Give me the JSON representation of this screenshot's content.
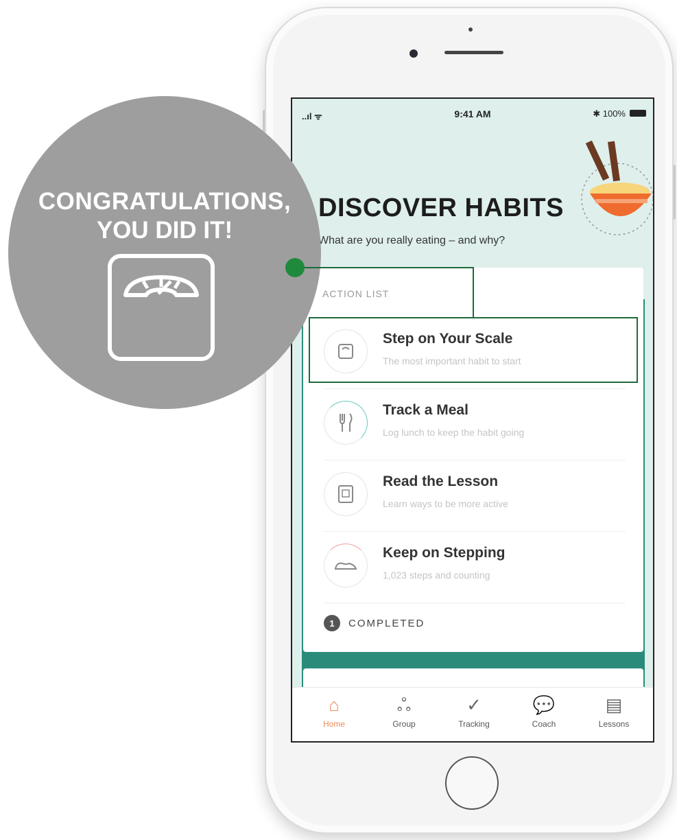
{
  "promo": {
    "congrats_line1": "CONGRATULATIONS,",
    "congrats_line2": "YOU DID IT!",
    "scale_icon": "bathroom-scale-icon",
    "accent_color": "#1f8a3c"
  },
  "status_bar": {
    "signal": "..ıl ᯤ",
    "time": "9:41 AM",
    "battery": "✱ 100%"
  },
  "header": {
    "title": "DISCOVER HABITS",
    "subtitle": "What are you really eating – and why?"
  },
  "action_list": {
    "label": "ACTION LIST",
    "items": [
      {
        "title": "Step on Your Scale",
        "subtitle": "The most important habit to start",
        "icon": "scale-icon"
      },
      {
        "title": "Track a Meal",
        "subtitle": "Log lunch to keep the habit going",
        "icon": "utensils-icon"
      },
      {
        "title": "Read the Lesson",
        "subtitle": "Learn ways to be more active",
        "icon": "book-icon"
      },
      {
        "title": "Keep on Stepping",
        "subtitle": "1,023 steps and counting",
        "icon": "shoe-icon"
      }
    ],
    "completed_count": "1",
    "completed_label": "COMPLETED"
  },
  "tabbar": {
    "tabs": [
      {
        "label": "Home",
        "icon": "home-icon",
        "active": true
      },
      {
        "label": "Group",
        "icon": "group-icon",
        "active": false
      },
      {
        "label": "Tracking",
        "icon": "tracking-icon",
        "active": false
      },
      {
        "label": "Coach",
        "icon": "coach-icon",
        "active": false
      },
      {
        "label": "Lessons",
        "icon": "lessons-icon",
        "active": false
      }
    ]
  },
  "colors": {
    "teal": "#2a8b7b",
    "mint_bg": "#dff0ec",
    "active_tab": "#f08b5c",
    "bubble": "#9e9e9e"
  }
}
